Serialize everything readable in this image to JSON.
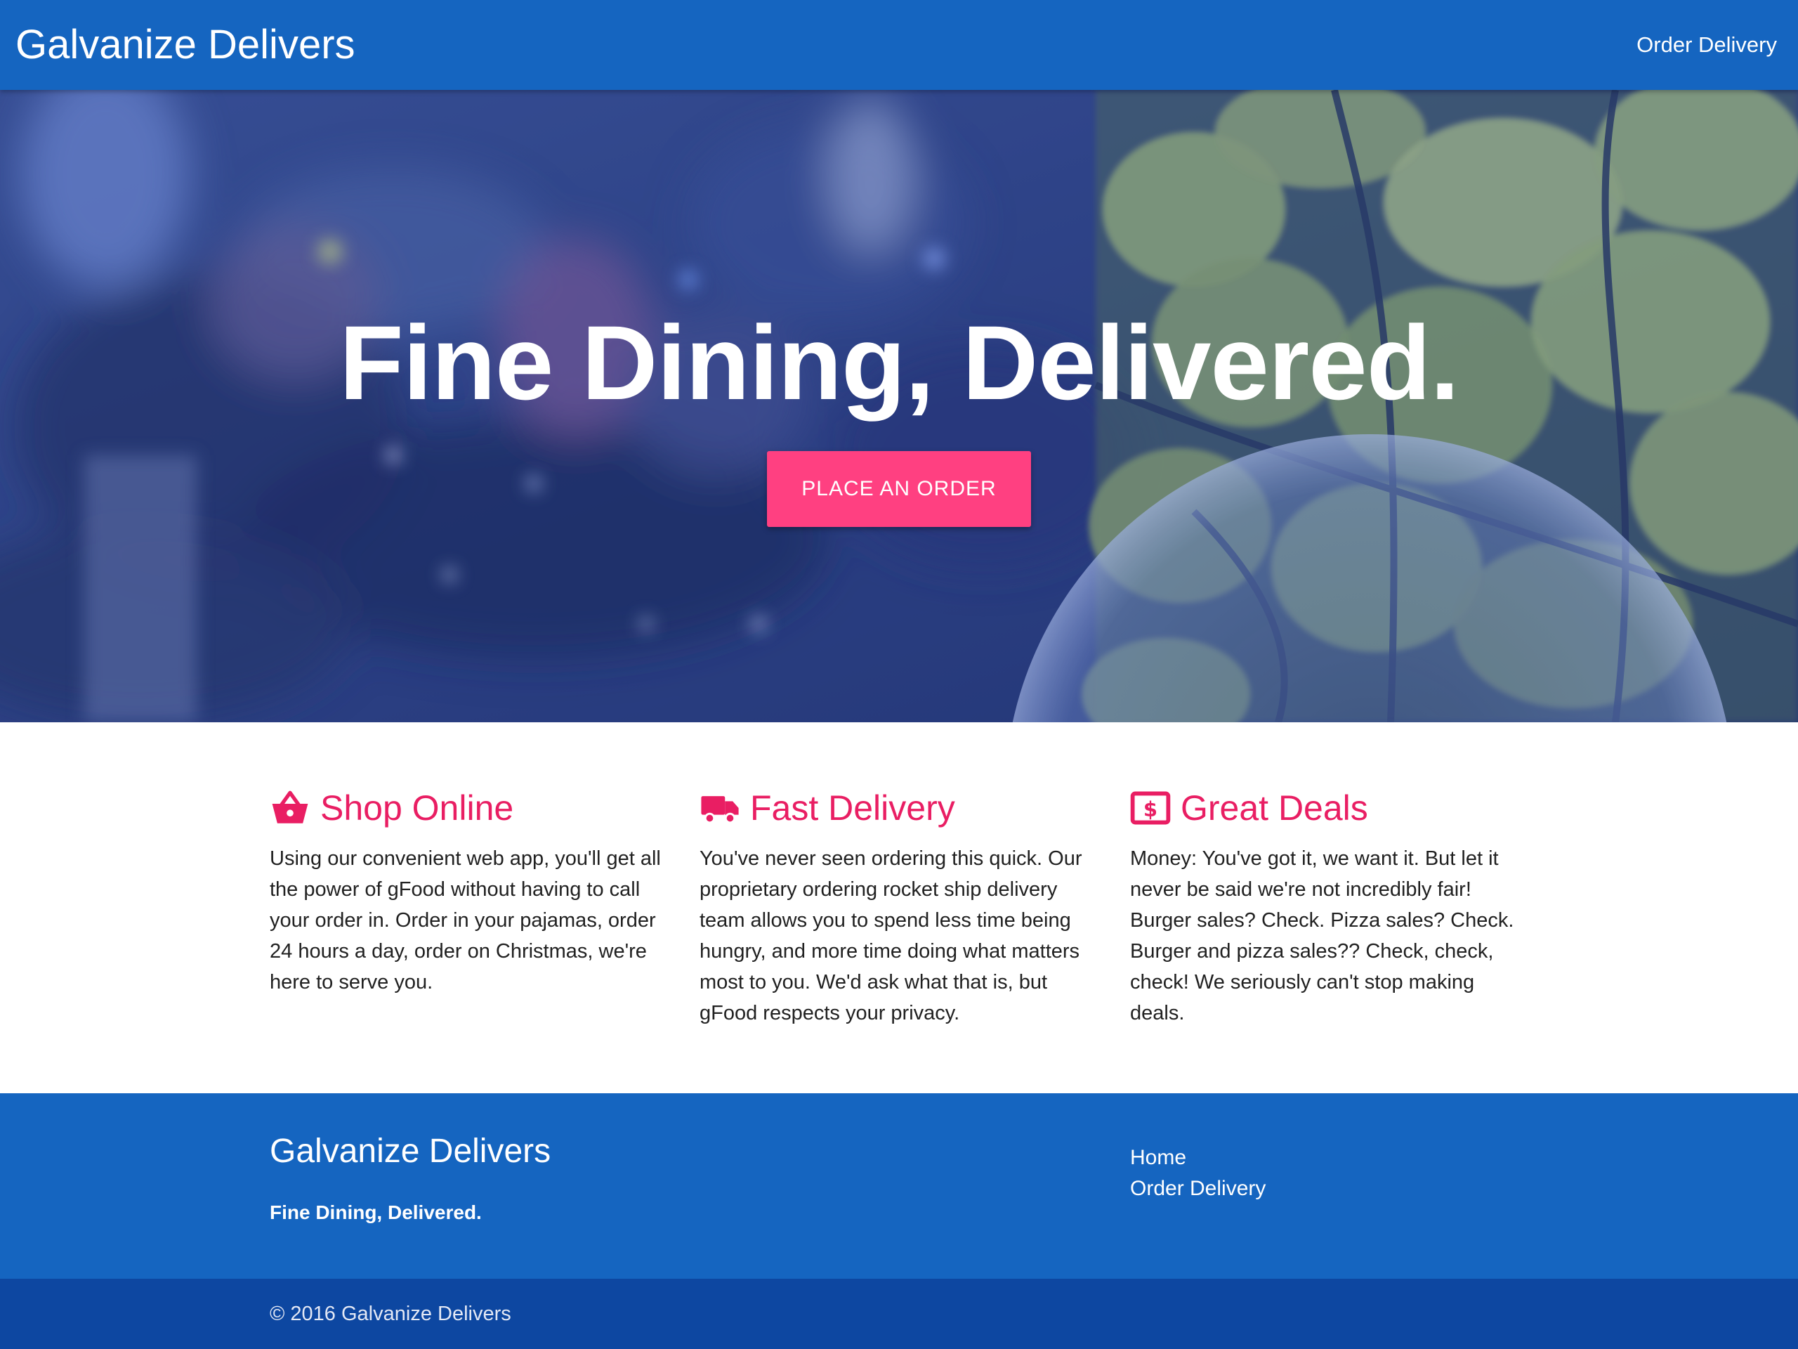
{
  "colors": {
    "primary": "#1565c0",
    "primary_dark": "#0d47a1",
    "accent": "#ff4081",
    "heading_accent": "#e91e63"
  },
  "navbar": {
    "brand": "Galvanize Delivers",
    "order_link": "Order Delivery"
  },
  "hero": {
    "title": "Fine Dining, Delivered.",
    "button_label": "PLACE AN ORDER"
  },
  "features": [
    {
      "icon": "shopping-basket-icon",
      "title": "Shop Online",
      "text": "Using our convenient web app, you'll get all the power of gFood without having to call your order in. Order in your pajamas, order 24 hours a day, order on Christmas, we're here to serve you."
    },
    {
      "icon": "truck-icon",
      "title": "Fast Delivery",
      "text": "You've never seen ordering this quick. Our proprietary ordering rocket ship delivery team allows you to spend less time being hungry, and more time doing what matters most to you. We'd ask what that is, but gFood respects your privacy."
    },
    {
      "icon": "money-icon",
      "title": "Great Deals",
      "text": "Money: You've got it, we want it. But let it never be said we're not incredibly fair! Burger sales? Check. Pizza sales? Check. Burger and pizza sales?? Check, check, check! We seriously can't stop making deals."
    }
  ],
  "footer": {
    "brand": "Galvanize Delivers",
    "tagline": "Fine Dining, Delivered.",
    "links": [
      "Home",
      "Order Delivery"
    ],
    "copyright": "© 2016 Galvanize Delivers"
  }
}
